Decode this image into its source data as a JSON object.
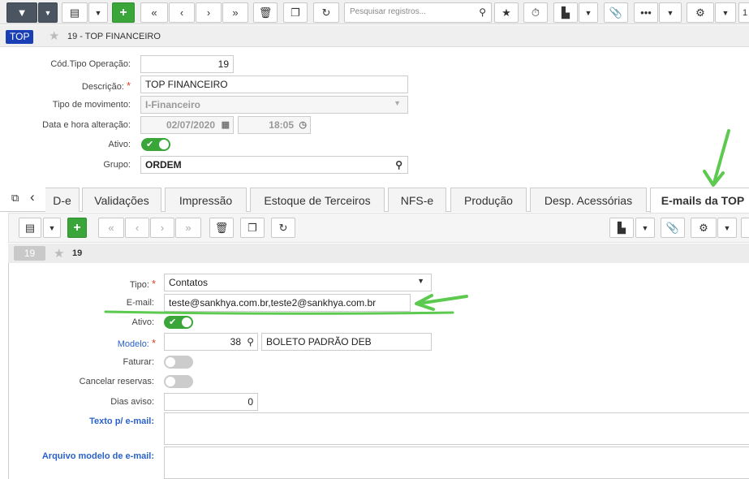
{
  "toolbar": {
    "search_placeholder": "Pesquisar registros...",
    "page_partial": "1"
  },
  "header": {
    "tag": "TOP",
    "title": "19 - TOP FINANCEIRO"
  },
  "form": {
    "cod_label": "Cód.Tipo Operação:",
    "cod_value": "19",
    "descricao_label": "Descrição:",
    "descricao_value": "TOP FINANCEIRO",
    "tipo_mov_label": "Tipo de movimento:",
    "tipo_mov_value": "I-Financeiro",
    "data_label": "Data e hora alteração:",
    "data_value": "02/07/2020",
    "hora_value": "18:05",
    "ativo_label": "Ativo:",
    "grupo_label": "Grupo:",
    "grupo_value": "ORDEM"
  },
  "tabs": [
    "D-e",
    "Validações",
    "Impressão",
    "Estoque de Terceiros",
    "NFS-e",
    "Produção",
    "Desp. Acessórias",
    "E-mails da TOP"
  ],
  "record": {
    "tag": "19",
    "title": "19"
  },
  "detail": {
    "tipo_label": "Tipo:",
    "tipo_value": "Contatos",
    "email_label": "E-mail:",
    "email_value": "teste@sankhya.com.br,teste2@sankhya.com.br",
    "ativo_label": "Ativo:",
    "modelo_label": "Modelo:",
    "modelo_code": "38",
    "modelo_desc": "BOLETO PADRÃO DEB",
    "faturar_label": "Faturar:",
    "cancelar_label": "Cancelar reservas:",
    "dias_label": "Dias aviso:",
    "dias_value": "0",
    "texto_label": "Texto p/ e-mail:",
    "arquivo_label": "Arquivo modelo de e-mail:"
  },
  "colors": {
    "accent_green": "#3aa63a",
    "tag_blue": "#1a3fb4",
    "annotation_green": "#5cc94f"
  }
}
